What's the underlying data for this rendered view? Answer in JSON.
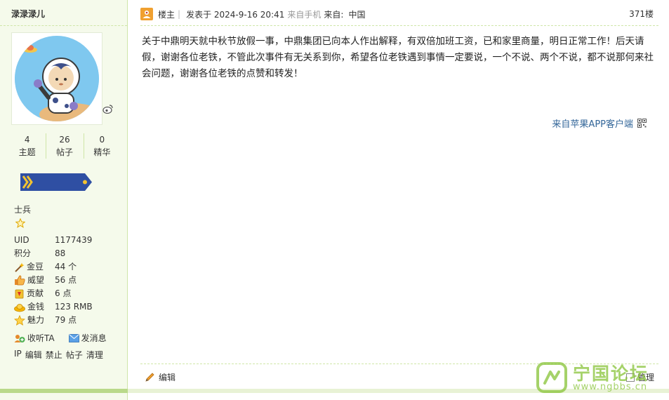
{
  "user": {
    "name": "渌渌渌儿",
    "stats": [
      {
        "value": "4",
        "label": "主题"
      },
      {
        "value": "26",
        "label": "帖子"
      },
      {
        "value": "0",
        "label": "精华"
      }
    ],
    "rank": "士兵",
    "rank_stars": 1,
    "info": [
      {
        "key": "UID",
        "value": "1177439",
        "icon": ""
      },
      {
        "key": "积分",
        "value": "88",
        "icon": ""
      },
      {
        "key": "金豆",
        "value": "44 个",
        "icon": "wand-icon"
      },
      {
        "key": "威望",
        "value": "56 点",
        "icon": "thumbs-up-icon"
      },
      {
        "key": "贡献",
        "value": "6 点",
        "icon": "medal-icon"
      },
      {
        "key": "金钱",
        "value": "123 RMB",
        "icon": "gold-ingot-icon"
      },
      {
        "key": "魅力",
        "value": "79 点",
        "icon": "star-icon"
      }
    ],
    "actions": {
      "follow": "收听TA",
      "message": "发消息"
    },
    "admin_links": [
      "IP",
      "编辑",
      "禁止",
      "帖子",
      "清理"
    ]
  },
  "post": {
    "author_role": "楼主",
    "posted_at": "发表于 2024-9-16 20:41",
    "from_mobile": "来自手机",
    "from_label": "来自:",
    "from_value": "中国",
    "floor": "371楼",
    "content": "关于中鼎明天就中秋节放假一事，中鼎集团已向本人作出解释，有双倍加班工资，已和家里商量，明日正常工作！后天请假，谢谢各位老铁，不管此次事件有无关系到你，希望各位老铁遇到事情一定要说，一个不说、两个不说，都不说那何来社会问题，谢谢各位老铁的点赞和转发！",
    "app_source": "来自苹果APP客户端",
    "edit_label": "编辑",
    "manage_label": "管理"
  },
  "watermark": {
    "title": "宁国论坛",
    "url": "www.ngbbs.cn"
  },
  "colors": {
    "sidebar_bg": "#f5faeb",
    "border": "#cfe6a8",
    "link": "#336699",
    "accent_green": "#8cc63f"
  }
}
